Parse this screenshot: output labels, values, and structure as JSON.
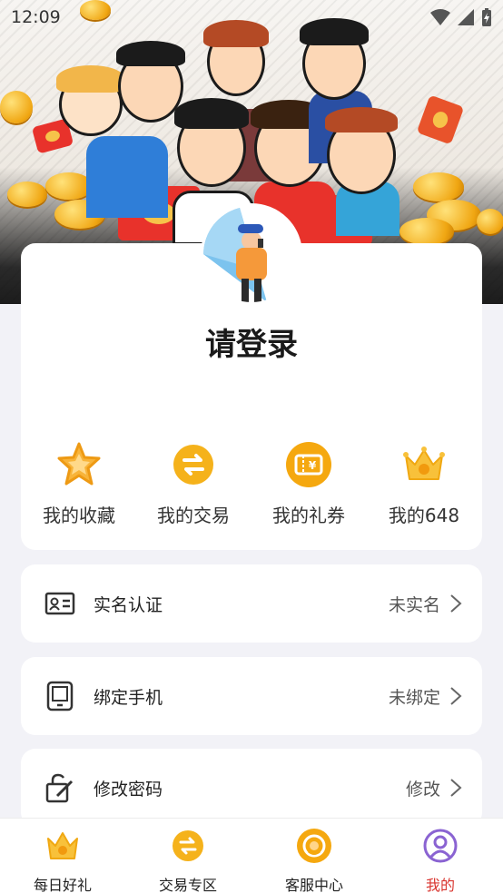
{
  "status_bar": {
    "time": "12:09"
  },
  "profile": {
    "login_prompt": "请登录"
  },
  "quick_actions": [
    {
      "label": "我的收藏",
      "icon": "star-icon"
    },
    {
      "label": "我的交易",
      "icon": "exchange-icon"
    },
    {
      "label": "我的礼券",
      "icon": "coupon-icon"
    },
    {
      "label": "我的648",
      "icon": "crown-icon"
    }
  ],
  "rows": [
    {
      "label": "实名认证",
      "value": "未实名",
      "icon": "id-card-icon"
    },
    {
      "label": "绑定手机",
      "value": "未绑定",
      "icon": "phone-icon"
    },
    {
      "label": "修改密码",
      "value": "修改",
      "icon": "edit-lock-icon"
    }
  ],
  "tabs": [
    {
      "label": "每日好礼",
      "icon": "crown-icon"
    },
    {
      "label": "交易专区",
      "icon": "exchange-icon"
    },
    {
      "label": "客服中心",
      "icon": "headset-icon"
    },
    {
      "label": "我的",
      "icon": "user-icon",
      "active": true
    }
  ],
  "colors": {
    "accent": "#f5b21b",
    "active_tab": "#d9352f",
    "tab_user_icon": "#8a63d2"
  }
}
